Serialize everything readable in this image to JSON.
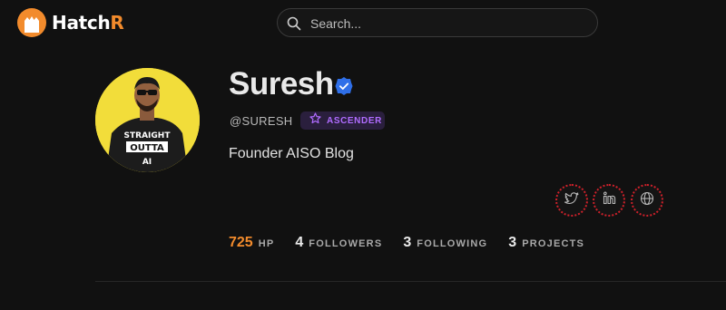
{
  "brand": {
    "name_prefix": "Hatch",
    "name_accent": "R",
    "accent_color": "#f28b2c"
  },
  "search": {
    "placeholder": "Search..."
  },
  "profile": {
    "name": "Suresh",
    "verified": true,
    "handle": "@SURESH",
    "badge": "ASCENDER",
    "bio": "Founder AISO Blog",
    "avatar_shirt_text": [
      "STRAIGHT",
      "OUTTA",
      "AI"
    ]
  },
  "social": [
    {
      "icon": "twitter-icon"
    },
    {
      "icon": "linkedin-icon"
    },
    {
      "icon": "globe-icon"
    }
  ],
  "stats": [
    {
      "value": "725",
      "label": "HP"
    },
    {
      "value": "4",
      "label": "FOLLOWERS"
    },
    {
      "value": "3",
      "label": "FOLLOWING"
    },
    {
      "value": "3",
      "label": "PROJECTS"
    }
  ]
}
